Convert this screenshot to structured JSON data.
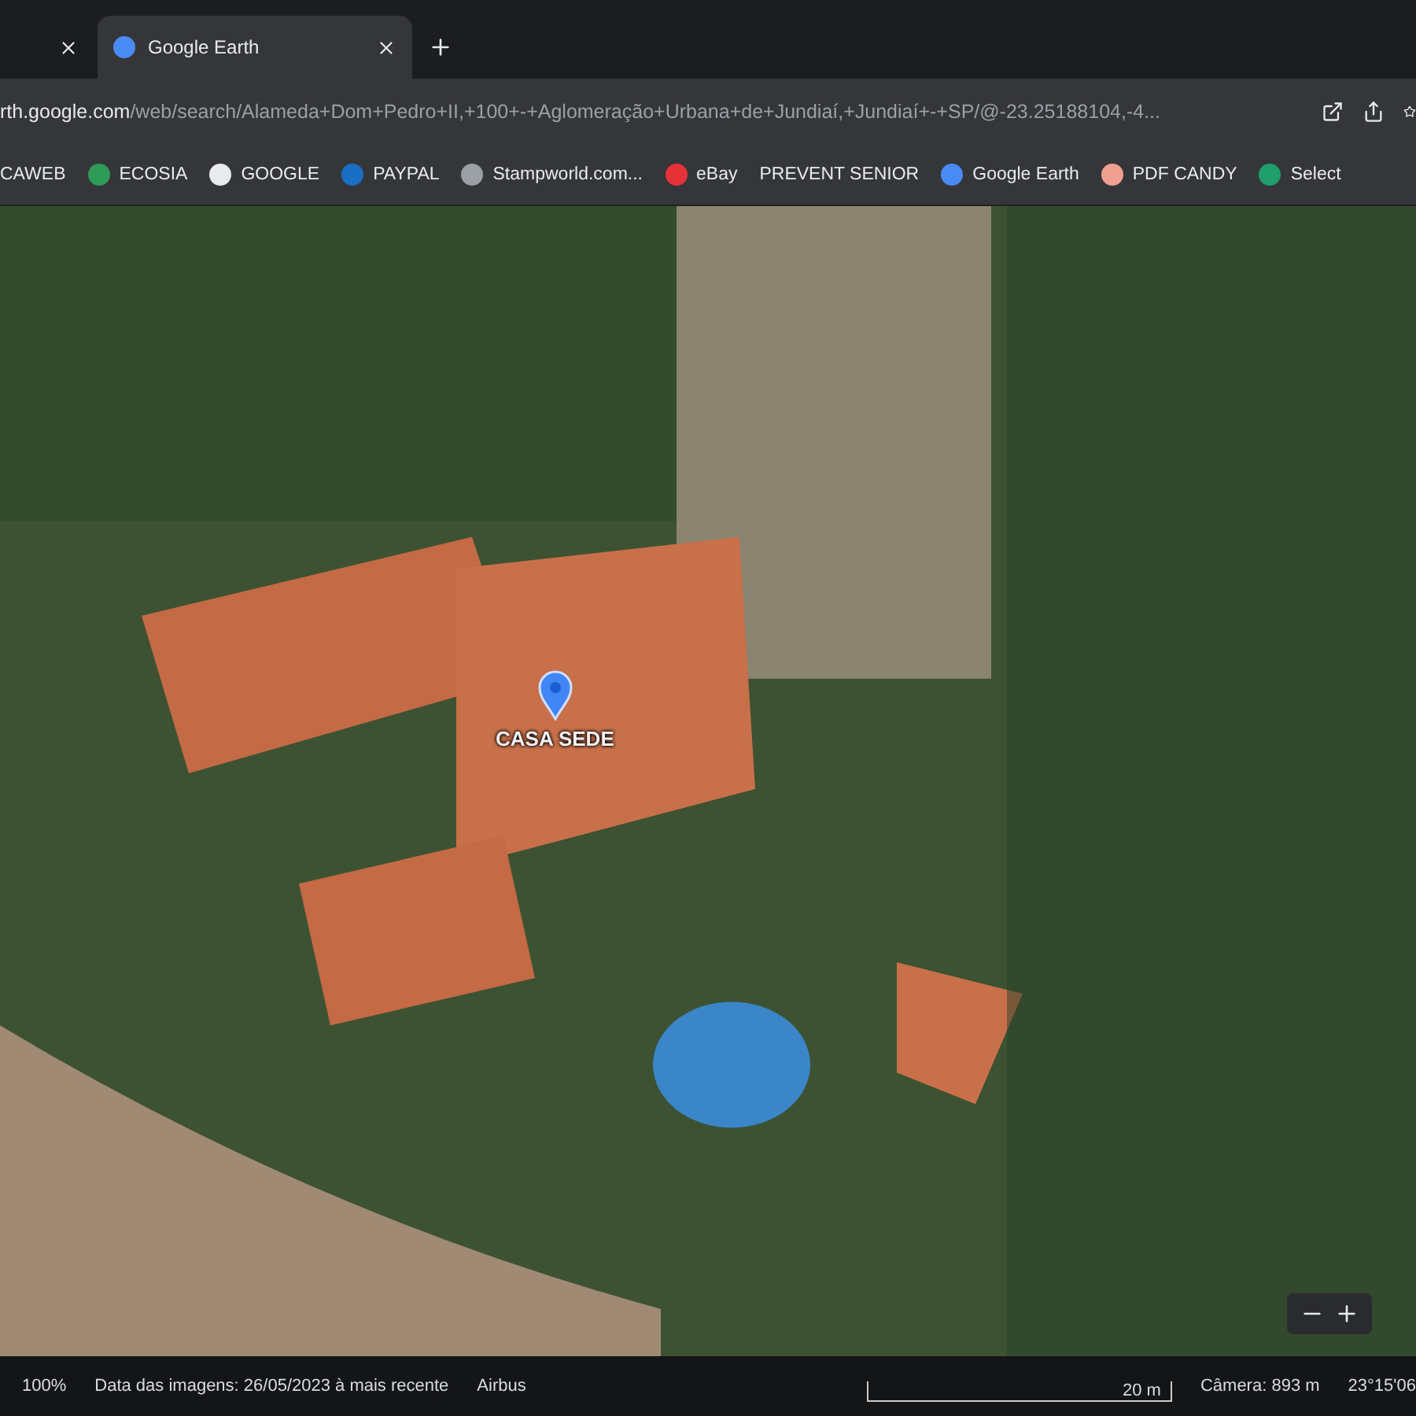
{
  "tabs": [
    {
      "selected": false
    },
    {
      "title": "Google Earth",
      "selected": true
    }
  ],
  "address": {
    "host": "rth.google.com",
    "path": "/web/search/Alameda+Dom+Pedro+II,+100+-+Aglomeração+Urbana+de+Jundiaí,+Jundiaí+-+SP/@-23.25188104,-4..."
  },
  "bookmarks": [
    {
      "label": "CAWEB",
      "kind": "none"
    },
    {
      "label": "ECOSIA",
      "kind": "leaf"
    },
    {
      "label": "GOOGLE",
      "kind": "google"
    },
    {
      "label": "PAYPAL",
      "kind": "paypal"
    },
    {
      "label": "Stampworld.com...",
      "kind": "globe"
    },
    {
      "label": "eBay",
      "kind": "ebay"
    },
    {
      "label": "PREVENT SENIOR",
      "kind": "none"
    },
    {
      "label": "Google Earth",
      "kind": "earth"
    },
    {
      "label": "PDF CANDY",
      "kind": "candy"
    },
    {
      "label": "Select",
      "kind": "select"
    }
  ],
  "map": {
    "placemark": "CASA SEDE"
  },
  "status_bar": {
    "zoom": "100%",
    "imagery_date": "Data das imagens: 26/05/2023 à mais recente",
    "provider": "Airbus",
    "scale": "20 m",
    "camera": "Câmera: 893 m",
    "coordinates": "23°15'06"
  }
}
